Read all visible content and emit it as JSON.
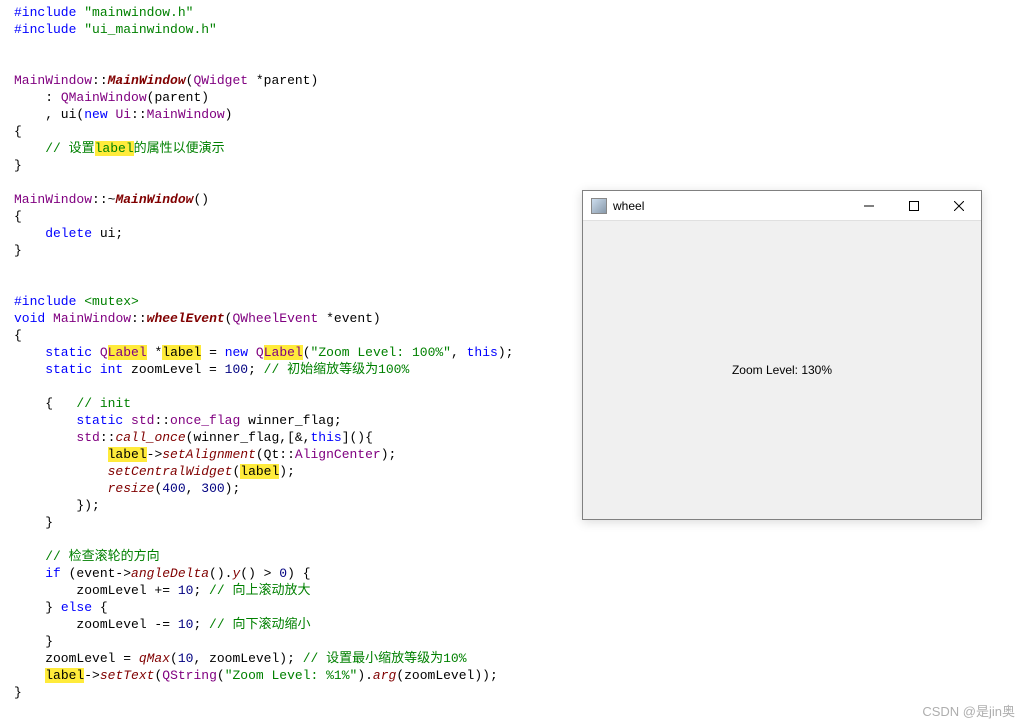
{
  "code": {
    "inc1a": "#include",
    "inc1b": "\"mainwindow.h\"",
    "inc2a": "#include",
    "inc2b": "\"ui_mainwindow.h\"",
    "ctor_scope": "MainWindow",
    "dbl": "::",
    "ctor_name": "MainWindow",
    "ctor_args_open": "(",
    "qwidget": "QWidget",
    "star_parent": " *parent)",
    "colon1": "    : ",
    "qmainwin": "QMainWindow",
    "parent_call": "(parent)",
    "comma_ui": "    , ui(",
    "new_kw": "new",
    "space": " ",
    "ui_ns": "Ui",
    "mainwin_t": "MainWindow",
    "close_paren": ")",
    "lbrace": "{",
    "cmt_set": "    // 设置",
    "hl_label1": "label",
    "cmt_set2": "的属性以便演示",
    "rbrace": "}",
    "dtor_scope": "MainWindow",
    "tilde": "~",
    "dtor_name": "MainWindow",
    "empty_parens": "()",
    "delete_kw": "    delete",
    "ui_semi": " ui;",
    "inc3a": "#include",
    "inc3b": "<mutex>",
    "void_kw": "void",
    "sp1": " ",
    "mw_scope": "MainWindow",
    "wheel_fn": "wheelEvent",
    "wheel_args_open": "(",
    "qwheel": "QWheelEvent",
    "star_event": " *event)",
    "static_kw": "    static",
    "qlabel": "QLabel",
    "star_sp": " *",
    "hl_label2": "label",
    "eq_new": " = ",
    "new_kw2": "new",
    "qlabel2": "QLabel",
    "open_p": "(",
    "zoom_str": "\"Zoom Level: 100%\"",
    "comma_this": ", ",
    "this_kw": "this",
    "close_p_semi": ");",
    "static_int": "    static",
    "int_kw": " int",
    "zoomlvl_decl": " zoomLevel = ",
    "hundred": "100",
    "semi": ";",
    "cmt_init_zoom": " // 初始缩放等级为100%",
    "open_init": "    {",
    "cmt_init": "   // init",
    "static_once": "        static",
    "std_ns": " std",
    "once_flag": "once_flag",
    "winner_flag": " winner_flag;",
    "std_call": "        std",
    "call_once": "call_once",
    "args_co": "(winner_flag,[&,",
    "this_kw2": "this",
    "lambda_close": "](){",
    "indent12": "            ",
    "hl_label3": "label",
    "arrow": "->",
    "setAlign": "setAlignment",
    "align_args": "(Qt::",
    "aligncenter": "AlignCenter",
    "close_p_semi2": ");",
    "setCentral": "setCentralWidget",
    "open_p2": "(",
    "hl_label4": "label",
    "close_p_semi3": ");",
    "resize_fn": "resize",
    "resize_args_open": "(",
    "n400": "400",
    "comma_sp": ", ",
    "n300": "300",
    "close_p_semi4": ");",
    "lambda_end": "        });",
    "close_init": "    }",
    "cmt_dir": "    // 检查滚轮的方向",
    "if_kw": "    if",
    "if_cond_pre": " (event->",
    "angleDelta": "angleDelta",
    "dot_y": "().",
    "y_fn": "y",
    "gt_zero": "() > ",
    "n0": "0",
    "if_open": ") {",
    "zoom_inc": "        zoomLevel += ",
    "n10a": "10",
    "semi2": ";",
    "cmt_up": " // 向上滚动放大",
    "else_line": "    } ",
    "else_kw": "else",
    "else_open": " {",
    "zoom_dec": "        zoomLevel -= ",
    "n10b": "10",
    "semi3": ";",
    "cmt_down": " // 向下滚动缩小",
    "close_else": "    }",
    "zoom_clamp_pre": "    zoomLevel = ",
    "qmax": "qMax",
    "qmax_open": "(",
    "n10c": "10",
    "comma_zl": ", zoomLevel);",
    "cmt_min": " // 设置最小缩放等级为10%",
    "indent4": "    ",
    "hl_label5": "label",
    "arrow3": "->",
    "setText": "setText",
    "settext_args_open": "(",
    "qstring": "QString",
    "qstring_open": "(",
    "fmt_str": "\"Zoom Level: %1%\"",
    "dot_arg": ").",
    "arg_fn": "arg",
    "arg_args": "(zoomLevel));"
  },
  "app": {
    "title": "wheel",
    "label_text": "Zoom Level: 130%"
  },
  "watermark": "CSDN @是jin奥"
}
